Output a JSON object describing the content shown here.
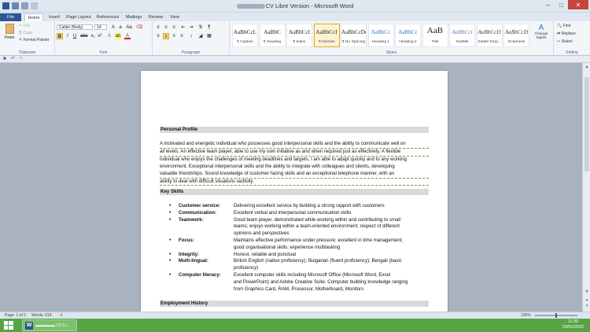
{
  "window": {
    "title_redacted": "▬▬▬▬▬",
    "title_visible": "CV Libre Version - Microsoft Word"
  },
  "ribbon_tabs": [
    "File",
    "Home",
    "Insert",
    "Page Layout",
    "References",
    "Mailings",
    "Review",
    "View"
  ],
  "active_tab": "Home",
  "clipboard": {
    "paste": "Paste",
    "cut": "Cut",
    "copy": "Copy",
    "format_painter": "Format Painter",
    "label": "Clipboard"
  },
  "font": {
    "family": "Calibri (Body)",
    "size": "14",
    "label": "Font"
  },
  "paragraph_label": "Paragraph",
  "styles": {
    "label": "Styles",
    "items": [
      {
        "preview": "AaBbCcL",
        "name": "¶ Caption"
      },
      {
        "preview": "AaBbC",
        "name": "¶ Heading"
      },
      {
        "preview": "AaBbCcI",
        "name": "¶ Index"
      },
      {
        "preview": "AaBbCcI",
        "name": "¶ Normal"
      },
      {
        "preview": "AaBbCcDd",
        "name": "¶ No Spacing"
      },
      {
        "preview": "AaBbCc",
        "name": "Heading 1"
      },
      {
        "preview": "AaBbCc",
        "name": "Heading 2"
      },
      {
        "preview": "AaB",
        "name": "Title"
      },
      {
        "preview": "AaBbCci",
        "name": "Subtitle"
      },
      {
        "preview": "AaBbCcD",
        "name": "Subtle Emp..."
      },
      {
        "preview": "AaBbCcD",
        "name": "Emphasis"
      }
    ],
    "selected_index": 3,
    "change_styles": "Change Styles"
  },
  "editing": {
    "find": "Find",
    "replace": "Replace",
    "select": "Select",
    "label": "Editing"
  },
  "document": {
    "section1_title": "Personal Profile",
    "profile_lines": [
      "A motivated and energetic individual who possesses good interpersonal skills and the ability to communicate well on",
      "all levels. An effective team player, able to use my own initiative as and when required just as effectively. A flexible",
      "individual who enjoys the challenges of meeting deadlines and targets, I am able to adapt quickly and to any working",
      "environment. Exceptional interpersonal skills and the ability to integrate with colleagues and clients, developing",
      "valuable friendships. Sound knowledge of customer facing skills and an exceptional telephone manner, with an",
      "ability to deal with difficult situations tactfully."
    ],
    "section2_title": "Key Skills",
    "skills": [
      {
        "key": "Customer service:",
        "lines": [
          "Delivering excellent service by building a strong rapport with customers"
        ]
      },
      {
        "key": "Communication:",
        "lines": [
          "Excellent verbal and interpersonal communication skills"
        ]
      },
      {
        "key": "Teamwork:",
        "lines": [
          "Good team player, demonstrated while working within and contributing to small",
          "teams; enjoys working within a team-oriented environment; respect of different",
          "opinions and perspectives"
        ]
      },
      {
        "key": "Focus:",
        "lines": [
          "Maintains effective performance under pressure; excellent in time management;",
          "good organisational skills; experience multitasking"
        ]
      },
      {
        "key": "Integrity:",
        "lines": [
          "Honest, reliable and punctual"
        ]
      },
      {
        "key": "Multi-lingual:",
        "lines": [
          "British English (native proficiency); Bulgarian (fluent proficiency); Bengali (basic",
          "proficiency)"
        ]
      },
      {
        "key": "Computer literacy:",
        "lines": [
          "Excellent computer skills including Microsoft Office (Microsoft Word, Excel",
          "and PowerPoint) and Adobe Creative Suite. Computer building knowledge ranging",
          "from Graphics Card, RAM, Processor, Motherboard, Monitors"
        ]
      }
    ],
    "section3_title": "Employment History"
  },
  "status": {
    "page": "Page: 1 of 2",
    "words": "Words: 618",
    "zoom": "100%"
  },
  "taskbar": {
    "time": "11:39",
    "date": "23/01/2022",
    "app_label": "▬▬▬▬▬ CV LI..."
  }
}
